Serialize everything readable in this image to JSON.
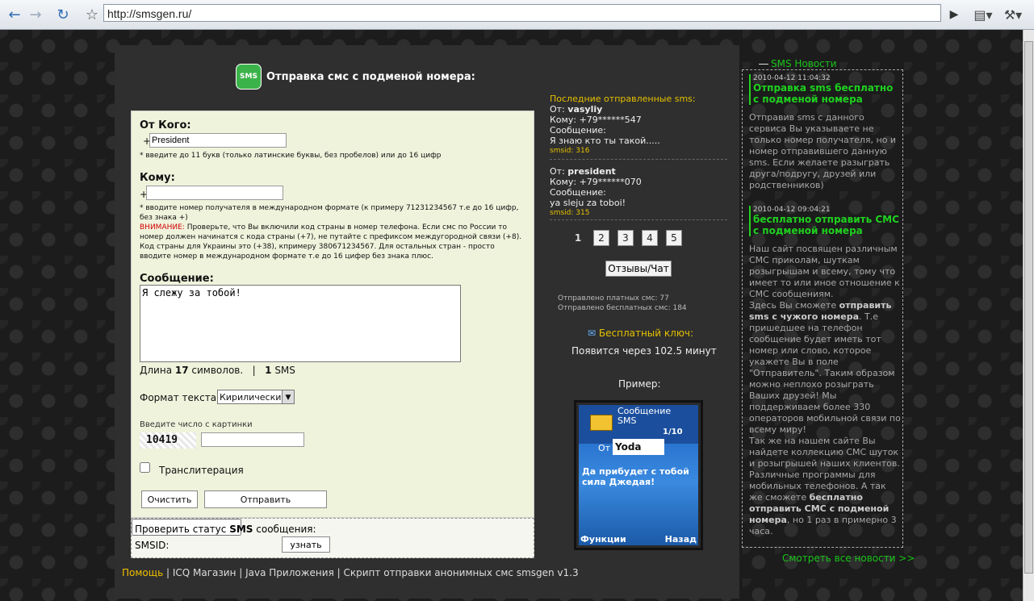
{
  "browser": {
    "url": "http://smsgen.ru/",
    "icons": [
      "back-icon",
      "forward-icon",
      "reload-icon",
      "star-icon",
      "go-icon",
      "page-menu-icon",
      "wrench-icon"
    ]
  },
  "header": {
    "icon_text": "SMS",
    "title": "Отправка смс с подменой номера:"
  },
  "form": {
    "from_label": "От Кого:",
    "from_plus": "+",
    "from_value": "President",
    "from_hint": "* введите до 11 букв (только латинские буквы, без пробелов) или до 16 цифр",
    "to_label": "Кому:",
    "to_plus": "+",
    "to_value": "",
    "to_hint": "* вводите номер получателя в международном формате (к примеру 71231234567 т.е до 16 цифр, без знака +)",
    "warning_label": "ВНИМАНИЕ:",
    "warning_text": " Проверьте, что Вы включили код страны в номер телефона. Если смс по России то номер должен начинатся с кода страны (+7), не путайте с префиксом междугородной связи (+8). Код страны для Украины это (+38), кпримеру 380671234567. Для остальных стран - просто вводите номер в международном формате т.е до 16 цифер без знака плюс.",
    "message_label": "Сообщение:",
    "message_value": "Я слежу за тобой!",
    "length_prefix": "Длина",
    "length_value": "17",
    "length_suffix": "символов.",
    "sep": "|",
    "sms_count": "1",
    "sms_label": "SMS",
    "format_label": "Формат текста:",
    "format_selected": "Кирилический",
    "captcha_label": "Введите число с картинки",
    "captcha_value": "10419",
    "captcha_input": "",
    "translit_label": "Транслитерация",
    "clear_button": "Очистить",
    "send_button": "Отправить"
  },
  "status_check": {
    "label_prefix": "Проверить статус",
    "label_sms": "SMS",
    "label_suffix": "сообщения:",
    "smsid_label": "SMSID:",
    "smsid_value": "",
    "button": "узнать"
  },
  "footer": {
    "help": "Помощь",
    "sep": "|",
    "links": [
      "ICQ Магазин",
      "Java Приложения",
      "Скрипт отправки анонимных смс smsgen v1.3"
    ]
  },
  "recent": {
    "title": "Последние отправленные sms:",
    "from_label": "От:",
    "to_label": "Кому:",
    "msg_label": "Сообщение:",
    "items": [
      {
        "from": "vasyliy",
        "to": "+79******547",
        "message": "Я знаю кто ты такой.....",
        "smsid": "smsid: 316"
      },
      {
        "from": "president",
        "to": "+79******070",
        "message": "ya sleju za toboi!",
        "smsid": "smsid: 315"
      }
    ],
    "pages": [
      "1",
      "2",
      "3",
      "4",
      "5"
    ],
    "current_page": "1",
    "reviews_button": "Отзывы/Чат",
    "stats_paid": "Отправлено платных смс: 77",
    "stats_free": "Отправлено бесплатных смс: 184",
    "free_key_label": "Бесплатный ключ:",
    "free_key_text": "Появится через 102.5 минут",
    "example_label": "Пример:"
  },
  "phone": {
    "header_title": "Сообщение SMS",
    "counter": "1/10",
    "from_label": "От",
    "from_value": "Yoda",
    "body": "Да прибудет с тобой сила Джедая!",
    "left_soft": "Функции",
    "right_soft": "Назад"
  },
  "news": {
    "title": "SMS Новости",
    "items": [
      {
        "date": "2010-04-12 11:04:32",
        "headline": "Отправка sms бесплатно с подменой номера",
        "body": "Отправив sms с данного сервиса Вы указываете не только номер получателя, но и номер отправившего данную sms. Если желаете разыграть друга/подругу, друзей или родственников)"
      },
      {
        "date": "2010-04-12 09:04:21",
        "headline": "бесплатно отправить СМС с подменой номера",
        "body_parts": [
          "Наш сайт посвящен различным СМС приколам, шуткам розыгрышам и всему, тому что имеет то или иное отношение к СМС сообщениям.",
          "Здесь Вы сможете ",
          "отправить sms с чужого номера",
          ". Т.е пришедшее на телефон сообщение будет иметь тот номер или слово, которое укажете Вы в поле \"Отправитель\". Таким образом можно неплохо розыграть Ваших друзей! Мы поддерживаем более 330 операторов мобильной связи по всему миру!",
          "Так же на нашем сайте Вы найдете коллекцию СМС шуток и розыгрышей наших клиентов. Различные программы для мобильных телефонов. А так же сможете ",
          "бесплатно отправить СМС с подменой номера",
          ", но 1 раз в примерно 3 часа."
        ]
      }
    ],
    "all_news": "Смотреть все новости >>"
  }
}
